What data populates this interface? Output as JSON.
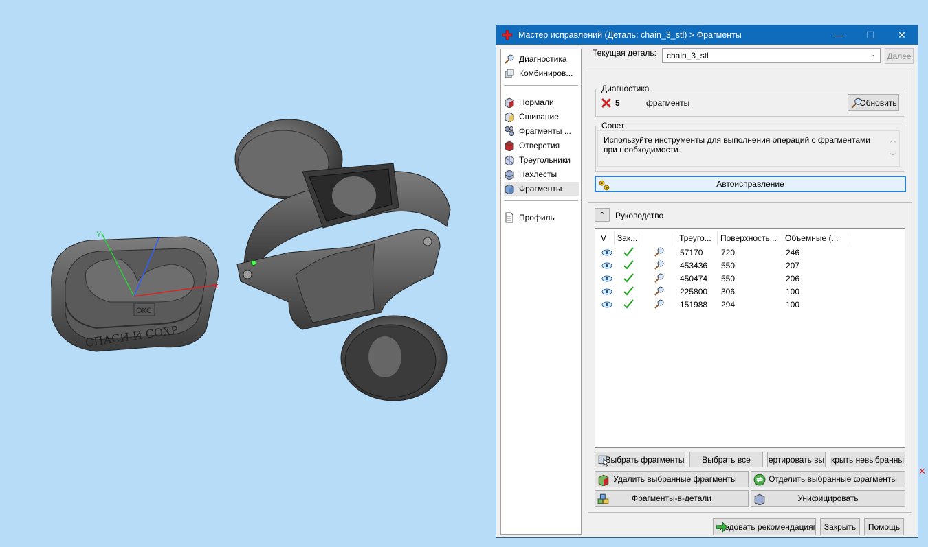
{
  "viewport": {
    "axis_label": "ОКС",
    "axis_x": "x",
    "ring_engraving": "СПАСИ И СОХР"
  },
  "dialog": {
    "title": "Мастер исправлений (Деталь: chain_3_stl) > Фрагменты",
    "window_controls": {
      "minimize": "—",
      "maximize": "☐",
      "close": "✕"
    },
    "nav": [
      {
        "label": "Диагностика",
        "icon": "magnifier-icon"
      },
      {
        "label": "Комбиниров...",
        "icon": "combine-icon"
      },
      {
        "label": "Нормали",
        "icon": "normals-icon"
      },
      {
        "label": "Сшивание",
        "icon": "stitch-icon"
      },
      {
        "label": "Фрагменты ...",
        "icon": "fragments-gear-icon"
      },
      {
        "label": "Отверстия",
        "icon": "holes-icon"
      },
      {
        "label": "Треугольники",
        "icon": "triangles-icon"
      },
      {
        "label": "Нахлесты",
        "icon": "overlaps-icon"
      },
      {
        "label": "Фрагменты",
        "icon": "fragments-icon",
        "selected": true
      },
      {
        "label": "Профиль",
        "icon": "document-icon"
      }
    ],
    "current_part_label": "Текущая деталь:",
    "current_part_value": "chain_3_stl",
    "next_button": "Далее",
    "diagnostics": {
      "title": "Диагностика",
      "count": "5",
      "status_text": "фрагменты",
      "refresh_button": "Обновить"
    },
    "advice": {
      "title": "Совет",
      "text": "Используйте инструменты для выполнения операций с фрагментами при необходимости."
    },
    "autofix_button": "Автоисправление",
    "guide_label": "Руководство",
    "table": {
      "columns": [
        "V",
        "Зак...",
        "",
        "Треуго...",
        "Поверхность...",
        "Объемные (..."
      ],
      "rows": [
        {
          "tri": "57170",
          "surf": "720",
          "vol": "246"
        },
        {
          "tri": "453436",
          "surf": "550",
          "vol": "207"
        },
        {
          "tri": "450474",
          "surf": "550",
          "vol": "206"
        },
        {
          "tri": "225800",
          "surf": "306",
          "vol": "100"
        },
        {
          "tri": "151988",
          "surf": "294",
          "vol": "100"
        }
      ]
    },
    "buttons": {
      "select_fragments": "Выбрать фрагменты",
      "select_all": "Выбрать все",
      "invert": "ертировать вы",
      "hide_unselected": "крыть невыбранны",
      "delete_selected": "Удалить выбранные фрагменты",
      "separate_selected": "Отделить выбранные фрагменты",
      "fragments_to_parts": "Фрагменты-в-детали",
      "unify": "Унифицировать",
      "follow_recommendations": "ледовать рекомендациям",
      "close": "Закрыть",
      "help": "Помощь"
    }
  }
}
